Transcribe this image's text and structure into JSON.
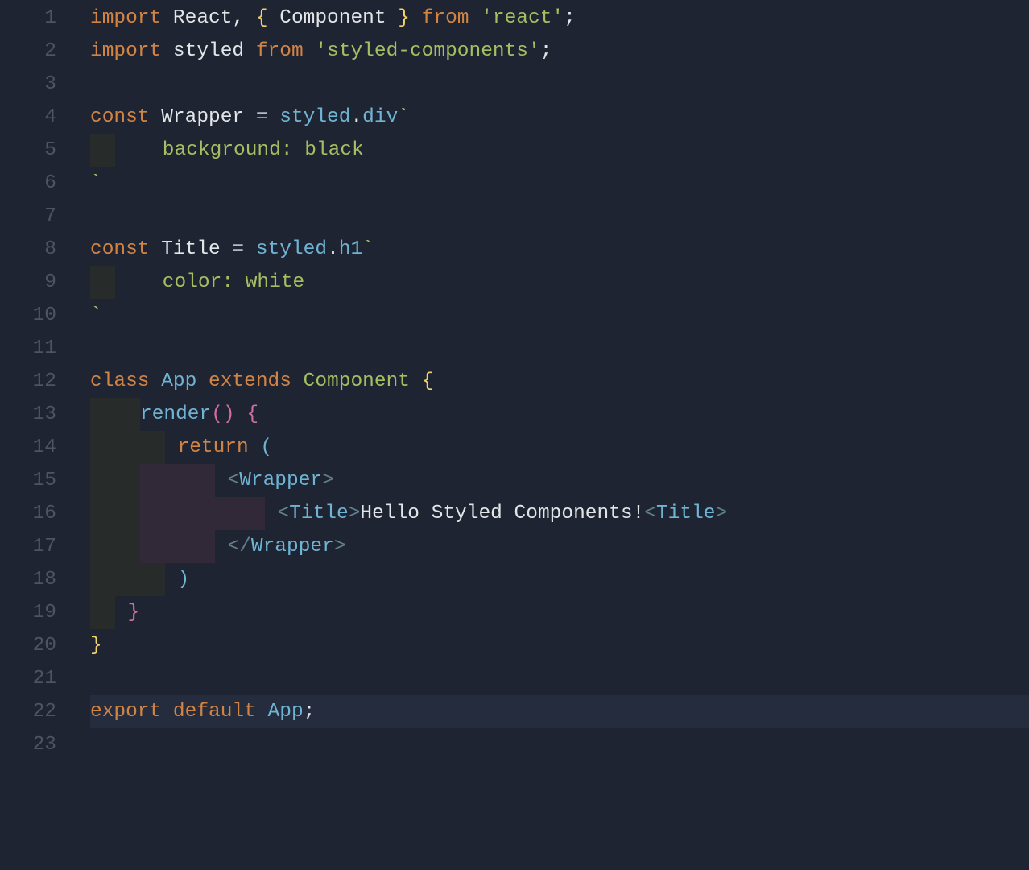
{
  "gutter": [
    "1",
    "2",
    "3",
    "4",
    "5",
    "6",
    "7",
    "8",
    "9",
    "10",
    "11",
    "12",
    "13",
    "14",
    "15",
    "16",
    "17",
    "18",
    "19",
    "20",
    "21",
    "22",
    "23"
  ],
  "code": {
    "l1": {
      "import": "import",
      "react": "React",
      "comma": ", ",
      "lb": "{ ",
      "comp": "Component",
      "rb": " }",
      "from": "from",
      "str": "'react'",
      "semi": ";"
    },
    "l2": {
      "import": "import",
      "styled": "styled",
      "from": "from",
      "str": "'styled-components'",
      "semi": ";"
    },
    "l4": {
      "const": "const",
      "name": "Wrapper",
      "eq": " = ",
      "styled": "styled",
      "dot": ".",
      "tag": "div",
      "bt": "`"
    },
    "l5": {
      "text": "    background: black"
    },
    "l6": {
      "bt": "`"
    },
    "l8": {
      "const": "const",
      "name": "Title",
      "eq": " = ",
      "styled": "styled",
      "dot": ".",
      "tag": "h1",
      "bt": "`"
    },
    "l9": {
      "text": "    color: white"
    },
    "l10": {
      "bt": "`"
    },
    "l12": {
      "class": "class",
      "app": "App",
      "extends": "extends",
      "comp": "Component",
      "lb": "{"
    },
    "l13": {
      "render": "render",
      "paren": "()",
      "lb": "{"
    },
    "l14": {
      "return": "return",
      "open": "("
    },
    "l15": {
      "lt": "<",
      "tag": "Wrapper",
      "gt": ">"
    },
    "l16": {
      "lt1": "<",
      "tag1": "Title",
      "gt1": ">",
      "text": "Hello Styled Components!",
      "lt2": "<",
      "tag2": "Title",
      "gt2": ">"
    },
    "l17": {
      "lt": "</",
      "tag": "Wrapper",
      "gt": ">"
    },
    "l18": {
      "close": ")"
    },
    "l19": {
      "rb": "}"
    },
    "l20": {
      "rb": "}"
    },
    "l22": {
      "export": "export",
      "default": "default",
      "app": "App",
      "semi": ";"
    }
  }
}
